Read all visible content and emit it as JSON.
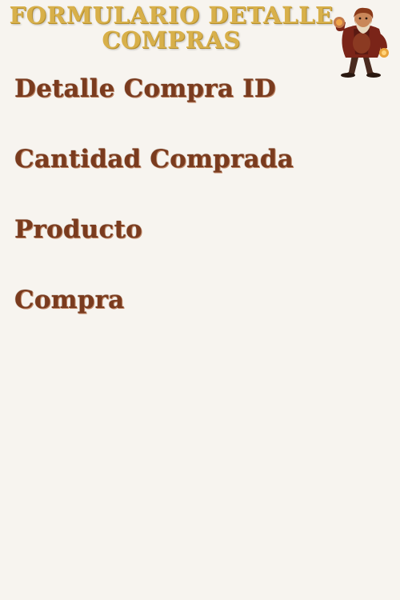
{
  "header": {
    "title_line1": "FORMULARIO DETALLE",
    "title_line2": "COMPRAS",
    "mascot_icon": "bearded-mascot-icon"
  },
  "form": {
    "fields": [
      {
        "label": "Detalle Compra ID"
      },
      {
        "label": "Cantidad Comprada"
      },
      {
        "label": "Producto"
      },
      {
        "label": "Compra"
      }
    ]
  },
  "colors": {
    "background": "#f7f4ef",
    "title": "#d8b04a",
    "label": "#7a3b1e"
  }
}
